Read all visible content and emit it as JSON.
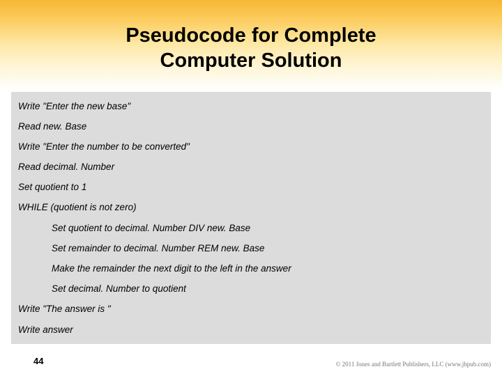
{
  "header": {
    "title_line1": "Pseudocode for Complete",
    "title_line2": "Computer Solution"
  },
  "code": {
    "lines": [
      {
        "text": "Write \"Enter the new base\"",
        "indent": false
      },
      {
        "text": "Read new. Base",
        "indent": false
      },
      {
        "text": "Write \"Enter the number to be converted\"",
        "indent": false
      },
      {
        "text": "Read decimal. Number",
        "indent": false
      },
      {
        "text": "Set quotient to 1",
        "indent": false
      },
      {
        "text": "WHILE (quotient is not zero)",
        "indent": false
      },
      {
        "text": "Set quotient to decimal. Number DIV new. Base",
        "indent": true
      },
      {
        "text": "Set remainder to decimal. Number REM new. Base",
        "indent": true
      },
      {
        "text": "Make the remainder the next digit to the left in the answer",
        "indent": true
      },
      {
        "text": "Set decimal. Number to quotient",
        "indent": true
      },
      {
        "text": "Write \"The answer is \"",
        "indent": false
      },
      {
        "text": "Write answer",
        "indent": false
      }
    ]
  },
  "footer": {
    "page_number": "44",
    "copyright": "© 2011 Jones and Bartlett Publishers, LLC (www.jbpub.com)"
  }
}
